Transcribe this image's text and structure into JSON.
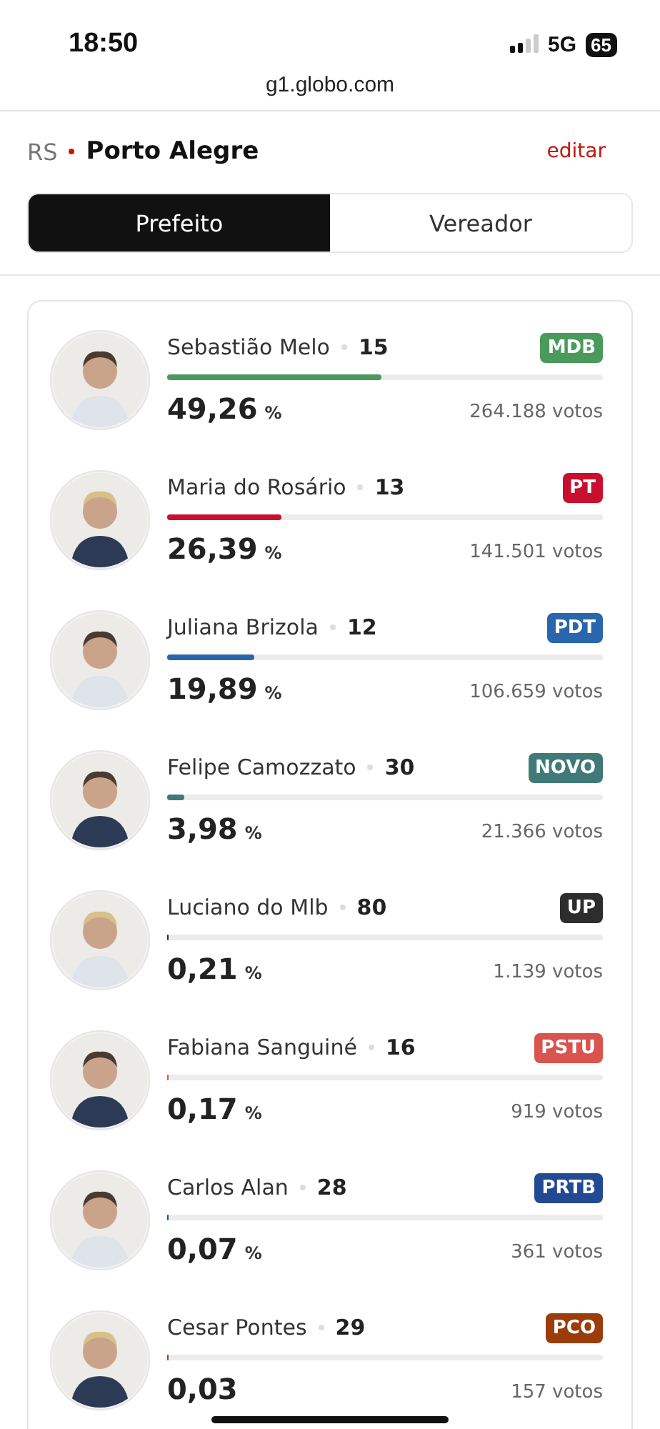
{
  "status_bar": {
    "time": "18:50",
    "network": "5G",
    "battery": "65"
  },
  "browser": {
    "url": "g1.globo.com"
  },
  "location": {
    "state": "RS",
    "city": "Porto Alegre",
    "edit_link": "editar"
  },
  "tabs": [
    {
      "label": "Prefeito",
      "selected": true
    },
    {
      "label": "Vereador",
      "selected": false
    }
  ],
  "candidates": [
    {
      "name": "Sebastião Melo",
      "number": "15",
      "party": "MDB",
      "color": "#4a9a5c",
      "level": 0.4926,
      "percent": "49,26",
      "unit": "%",
      "votes": "264.188 votos"
    },
    {
      "name": "Maria do Rosário",
      "number": "13",
      "party": "PT",
      "color": "#c8102e",
      "level": 0.2639,
      "percent": "26,39",
      "unit": "%",
      "votes": "141.501 votos"
    },
    {
      "name": "Juliana Brizola",
      "number": "12",
      "party": "PDT",
      "color": "#2a66ad",
      "level": 0.1989,
      "percent": "19,89",
      "unit": "%",
      "votes": "106.659 votos"
    },
    {
      "name": "Felipe Camozzato",
      "number": "30",
      "party": "NOVO",
      "color": "#3f7a78",
      "level": 0.0398,
      "percent": "3,98",
      "unit": "%",
      "votes": "21.366 votos"
    },
    {
      "name": "Luciano do Mlb",
      "number": "80",
      "party": "UP",
      "color": "#2d2d2d",
      "level": 0.0021,
      "percent": "0,21",
      "unit": "%",
      "votes": "1.139 votos"
    },
    {
      "name": "Fabiana Sanguiné",
      "number": "16",
      "party": "PSTU",
      "color": "#d9534f",
      "level": 0.0017,
      "percent": "0,17",
      "unit": "%",
      "votes": "919 votos"
    },
    {
      "name": "Carlos Alan",
      "number": "28",
      "party": "PRTB",
      "color": "#224a94",
      "level": 0.0007,
      "percent": "0,07",
      "unit": "%",
      "votes": "361 votos"
    },
    {
      "name": "Cesar Pontes",
      "number": "29",
      "party": "PCO",
      "color": "#9a3d0b",
      "level": 0.0003,
      "percent": "0,03",
      "votes": "157 votos"
    }
  ]
}
